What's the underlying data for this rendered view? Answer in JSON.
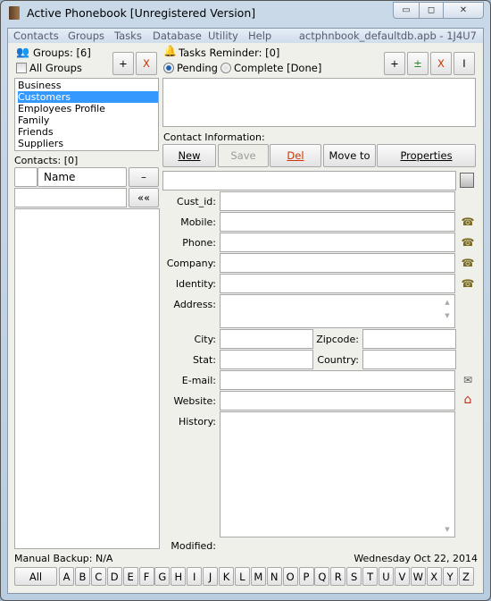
{
  "window": {
    "title": "Active Phonebook [Unregistered Version]"
  },
  "menu": {
    "items": [
      "Contacts",
      "Groups",
      "Tasks",
      "Database",
      "Utility",
      "Help"
    ],
    "db": "actphnbook_defaultdb.apb - 1J4U7"
  },
  "groups": {
    "label": "Groups: [6]",
    "all_label": "All Groups",
    "add": "+",
    "remove": "X",
    "items": [
      "Business",
      "Customers",
      "Employees Profile",
      "Family",
      "Friends",
      "Suppliers"
    ],
    "selected": "Customers"
  },
  "tasks": {
    "label": "Tasks Reminder: [0]",
    "pending": "Pending",
    "complete": "Complete [Done]",
    "buttons": [
      "+",
      "±",
      "X",
      "I"
    ]
  },
  "contact_info": {
    "label": "Contact Information:",
    "buttons": {
      "new": "New",
      "save": "Save",
      "del": "Del",
      "move": "Move to",
      "properties": "Properties"
    }
  },
  "contacts": {
    "label": "Contacts: [0]",
    "name_header": "Name",
    "minus": "–",
    "back": "««"
  },
  "fields": {
    "cust_id": "Cust_id:",
    "mobile": "Mobile:",
    "phone": "Phone:",
    "company": "Company:",
    "identity": "Identity:",
    "address": "Address:",
    "city": "City:",
    "zipcode": "Zipcode:",
    "stat": "Stat:",
    "country": "Country:",
    "email": "E-mail:",
    "website": "Website:",
    "history": "History:",
    "modified": "Modified:"
  },
  "status": {
    "backup": "Manual Backup: N/A",
    "date": "Wednesday Oct 22, 2014"
  },
  "alphabet": {
    "all": "All",
    "letters": [
      "A",
      "B",
      "C",
      "D",
      "E",
      "F",
      "G",
      "H",
      "I",
      "J",
      "K",
      "L",
      "M",
      "N",
      "O",
      "P",
      "Q",
      "R",
      "S",
      "T",
      "U",
      "V",
      "W",
      "X",
      "Y",
      "Z"
    ]
  },
  "colors": {
    "selection": "#3399ff",
    "delete": "#cc3300",
    "plusminus": "#2a8a2a"
  }
}
